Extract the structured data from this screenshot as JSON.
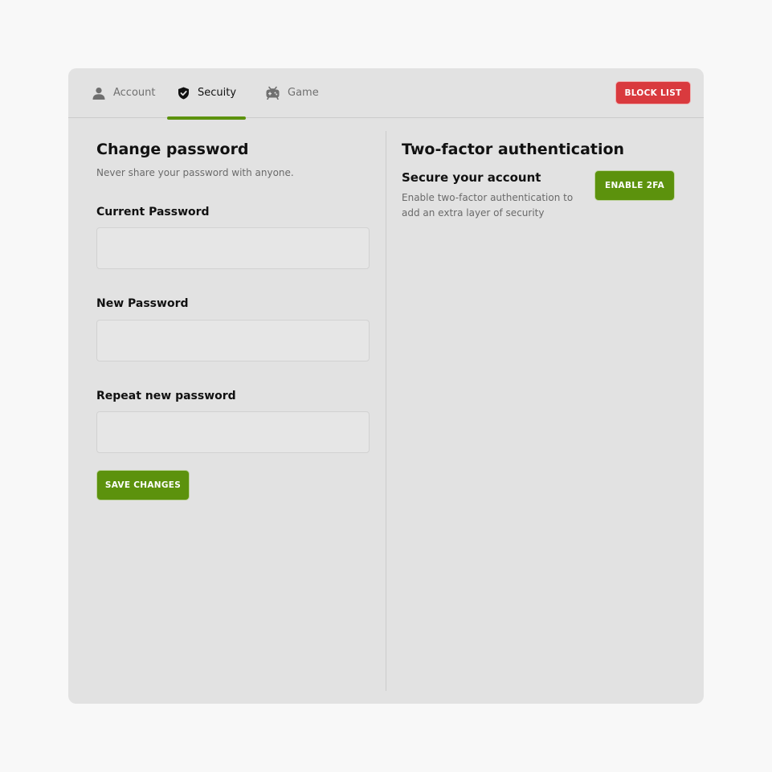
{
  "tabs": [
    {
      "label": "Account",
      "icon": "user-icon",
      "active": false
    },
    {
      "label": "Secuity",
      "icon": "shield-check-icon",
      "active": true
    },
    {
      "label": "Game",
      "icon": "gamepad-icon",
      "active": false
    }
  ],
  "header": {
    "block_list_label": "BLOCK LIST"
  },
  "change_password": {
    "title": "Change password",
    "subtitle": "Never share your password with anyone.",
    "current_label": "Current Password",
    "current_value": "",
    "new_label": "New Password",
    "new_value": "",
    "repeat_label": "Repeat new password",
    "repeat_value": "",
    "save_label": "SAVE CHANGES"
  },
  "two_factor": {
    "title": "Two-factor authentication",
    "subtitle": "Secure your account",
    "description": "Enable two-factor authentication to add an extra layer of security",
    "enable_label": "ENABLE 2FA"
  },
  "colors": {
    "accent_green": "#5c920d",
    "danger_red": "#d93a3e",
    "panel_bg": "#e2e2e2",
    "page_bg": "#f8f8f8"
  }
}
